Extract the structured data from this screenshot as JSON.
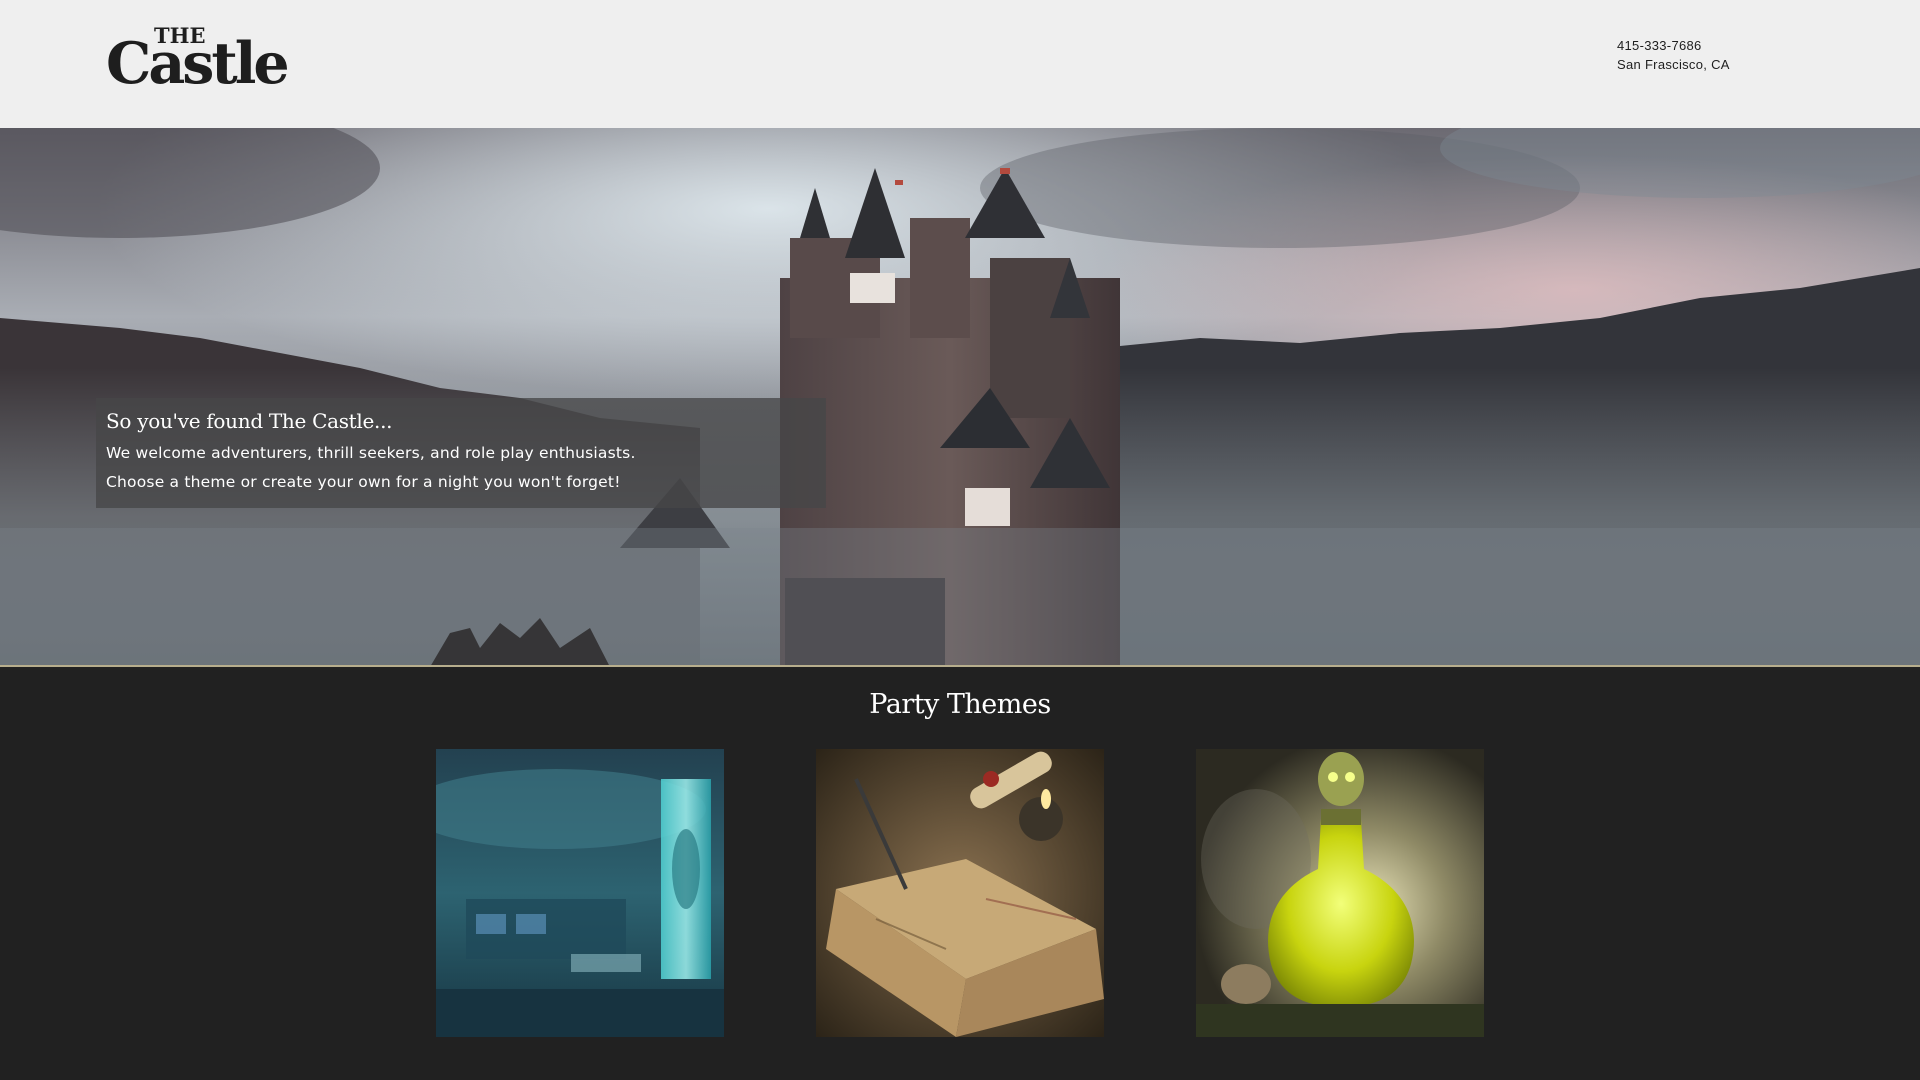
{
  "header": {
    "logo": {
      "top_word": "THE",
      "main_word": "Castle"
    },
    "contact": {
      "phone": "415-333-7686",
      "location": "San Frascisco, CA"
    }
  },
  "hero": {
    "title": "So you've found The Castle...",
    "line1": "We welcome adventurers, thrill seekers, and role play enthusiasts.",
    "line2": "Choose a theme or create your own for a night you won't forget!"
  },
  "themes": {
    "heading": "Party Themes",
    "cards": [
      {
        "icon": "underwater-lab-image"
      },
      {
        "icon": "ancient-scroll-book-image"
      },
      {
        "icon": "skull-potion-image"
      }
    ]
  },
  "colors": {
    "header_bg": "#efefef",
    "body_bg": "#212121",
    "hero_divider": "#b7ae8d",
    "text_dark": "#1e1e1e",
    "text_light": "#ffffff"
  }
}
